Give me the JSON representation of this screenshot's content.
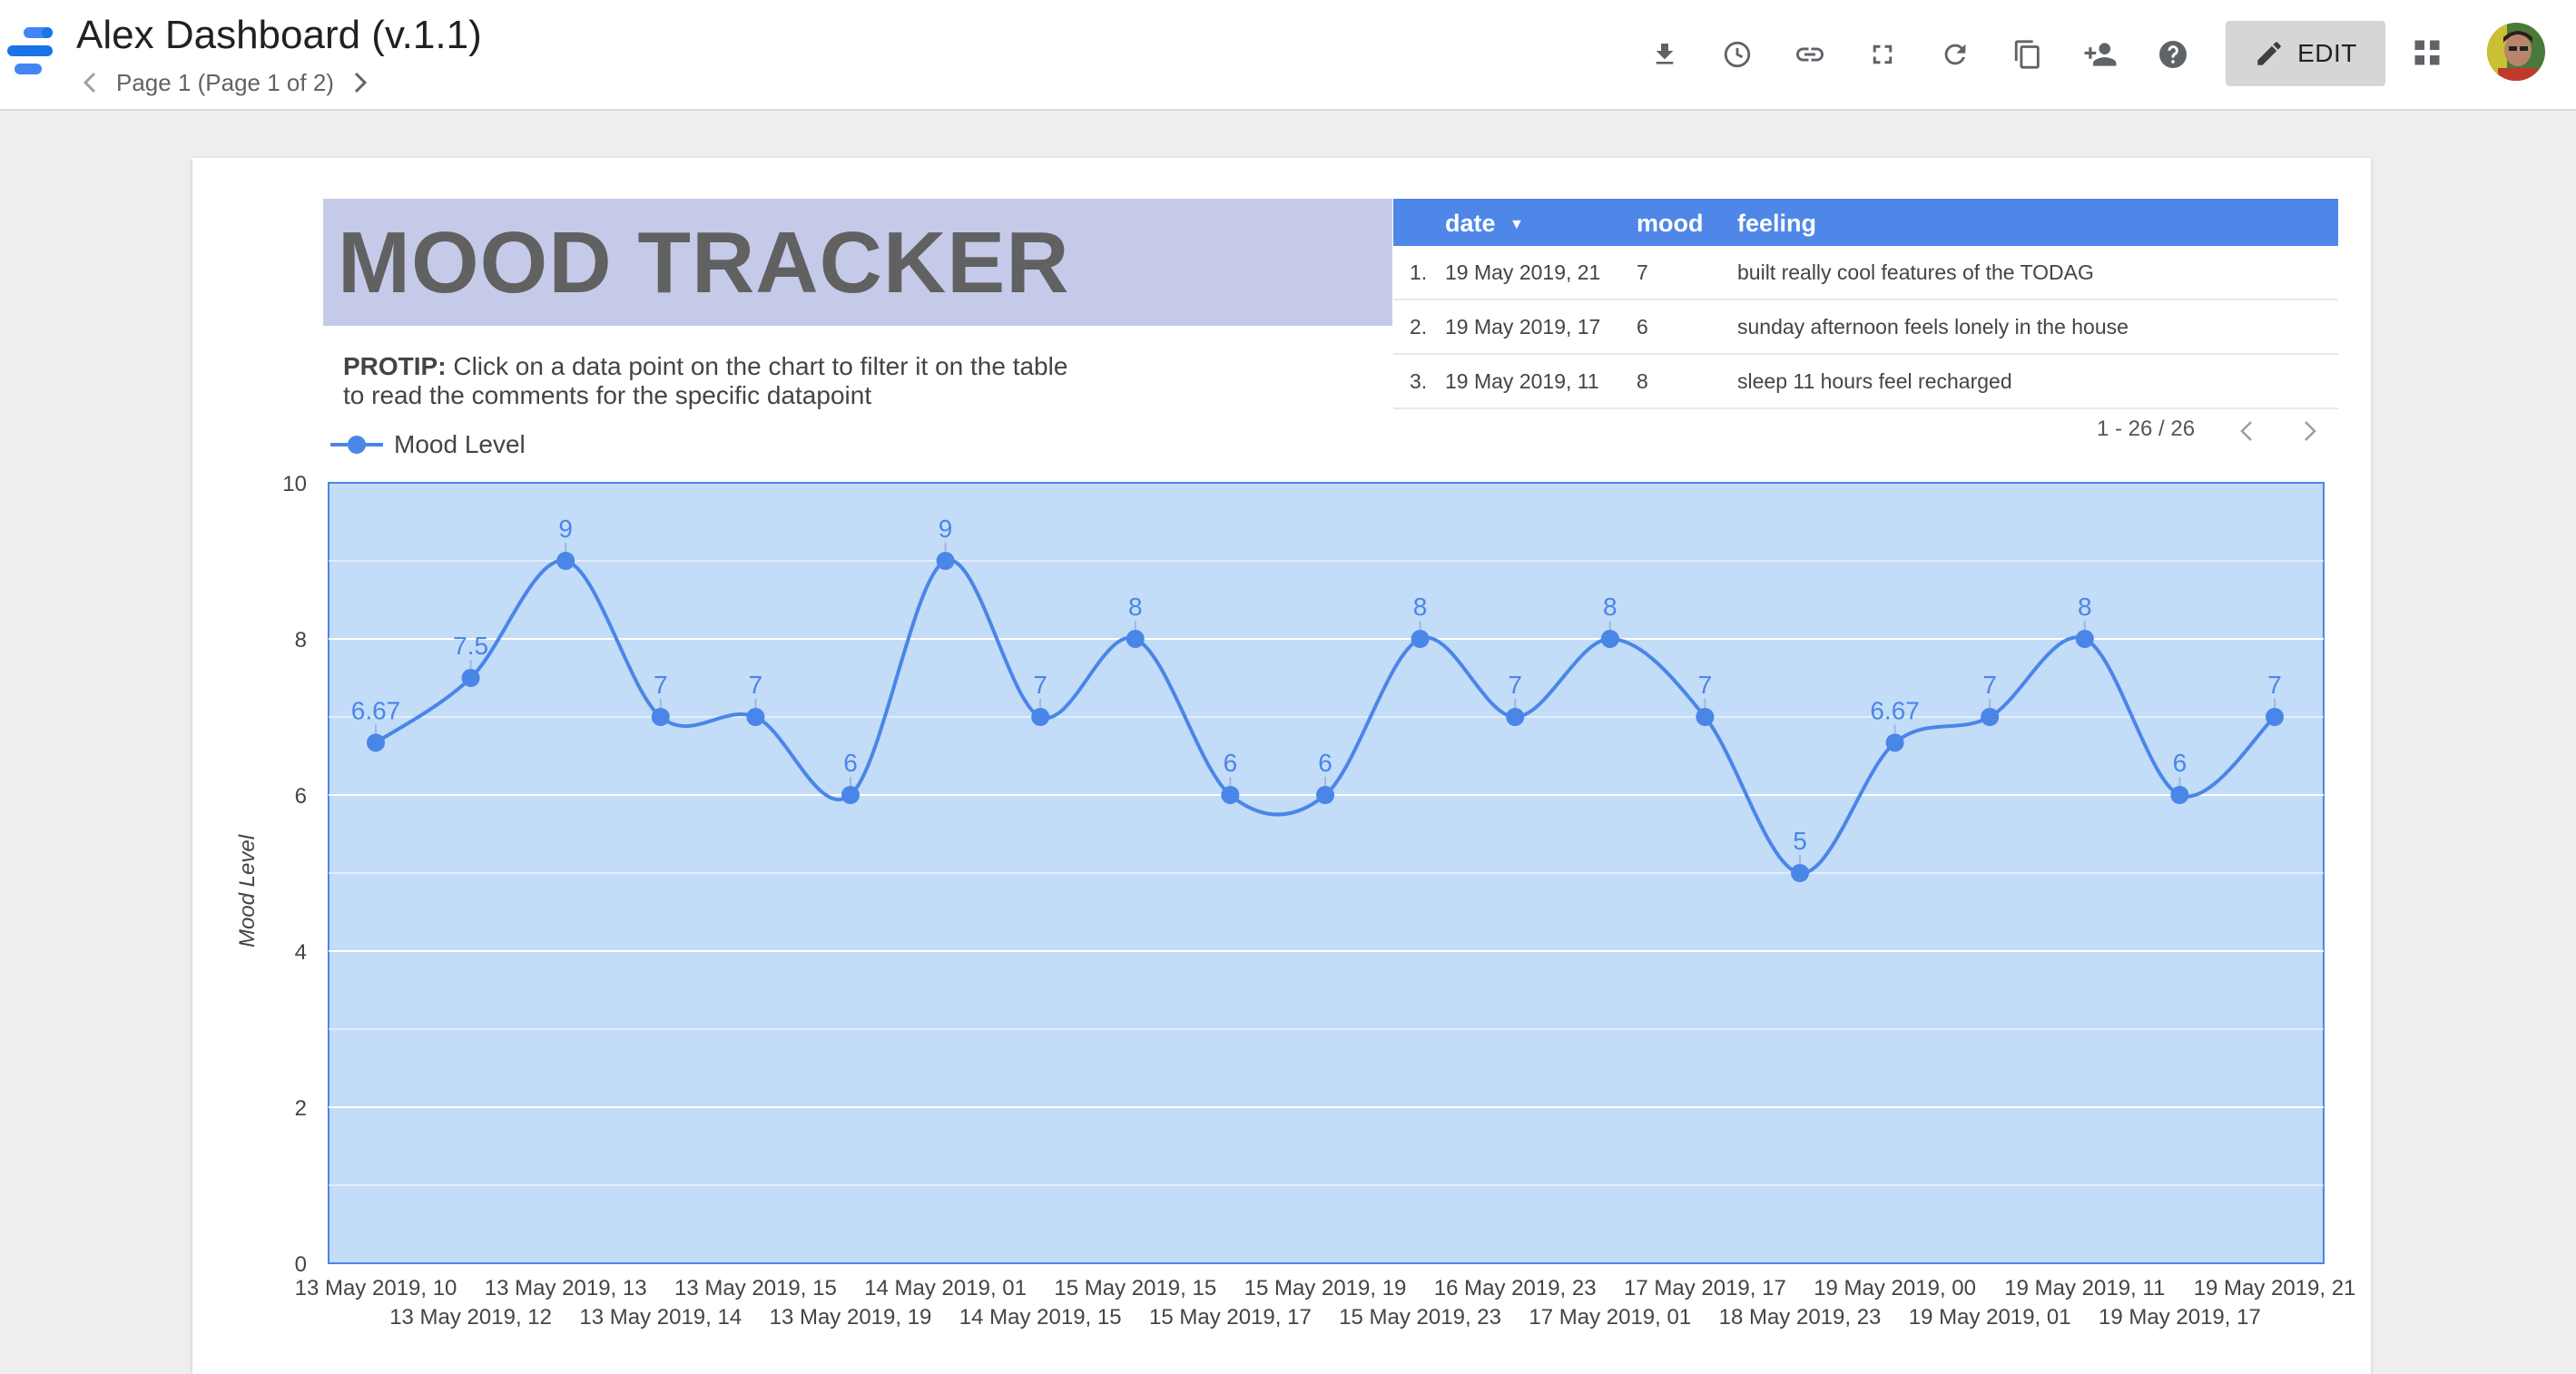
{
  "app": {
    "title": "Alex Dashboard (v.1.1)",
    "page_label": "Page 1 (Page 1 of 2)",
    "edit_label": "EDIT",
    "toolbar_icons": [
      "download-icon",
      "history-icon",
      "link-icon",
      "fullscreen-icon",
      "refresh-icon",
      "copy-icon",
      "add-person-icon",
      "help-icon"
    ]
  },
  "report": {
    "title": "MOOD TRACKER",
    "protip_label": "PROTIP:",
    "protip_text": " Click on a data point on the chart to filter it on the table to read the comments for the specific datapoint"
  },
  "table": {
    "headers": {
      "date": "date",
      "mood": "mood",
      "feeling": "feeling"
    },
    "sort_indicator": "▼",
    "rows": [
      {
        "index": "1.",
        "date": "19 May 2019, 21",
        "mood": "7",
        "feeling": "built really cool features of the TODAG"
      },
      {
        "index": "2.",
        "date": "19 May 2019, 17",
        "mood": "6",
        "feeling": "sunday afternoon feels lonely in the house"
      },
      {
        "index": "3.",
        "date": "19 May 2019, 11",
        "mood": "8",
        "feeling": "sleep 11 hours feel recharged"
      }
    ],
    "pager": "1 - 26 / 26"
  },
  "colors": {
    "accent": "#4f87e8",
    "title_bg": "#c5cae9",
    "plot_bg": "#c3dcf7",
    "line": "#4a86e8",
    "edit_bg": "#d6d6d6"
  },
  "chart_data": {
    "type": "line",
    "title": "",
    "xlabel": "",
    "ylabel": "Mood Level",
    "legend": "top-left",
    "grid": true,
    "ylim": [
      0,
      10
    ],
    "yticks": [
      0,
      2,
      4,
      6,
      8,
      10
    ],
    "categories": [
      "13 May 2019, 10",
      "13 May 2019, 12",
      "13 May 2019, 13",
      "13 May 2019, 14",
      "13 May 2019, 15",
      "13 May 2019, 19",
      "14 May 2019, 01",
      "14 May 2019, 15",
      "15 May 2019, 15",
      "15 May 2019, 17",
      "15 May 2019, 19",
      "15 May 2019, 23",
      "16 May 2019, 23",
      "17 May 2019, 01",
      "17 May 2019, 17",
      "18 May 2019, 23",
      "19 May 2019, 00",
      "19 May 2019, 01",
      "19 May 2019, 11",
      "19 May 2019, 17",
      "19 May 2019, 21"
    ],
    "series": [
      {
        "name": "Mood Level",
        "values": [
          6.67,
          7.5,
          9,
          7,
          7,
          6,
          9,
          7,
          8,
          6,
          6,
          8,
          7,
          8,
          7,
          5,
          6.67,
          7,
          8,
          6,
          7
        ],
        "labels": [
          "6.67",
          "7.5",
          "9",
          "7",
          "7",
          "6",
          "9",
          "7",
          "8",
          "6",
          "6",
          "8",
          "7",
          "8",
          "7",
          "5",
          "6.67",
          "7",
          "8",
          "6",
          "7"
        ]
      }
    ]
  }
}
